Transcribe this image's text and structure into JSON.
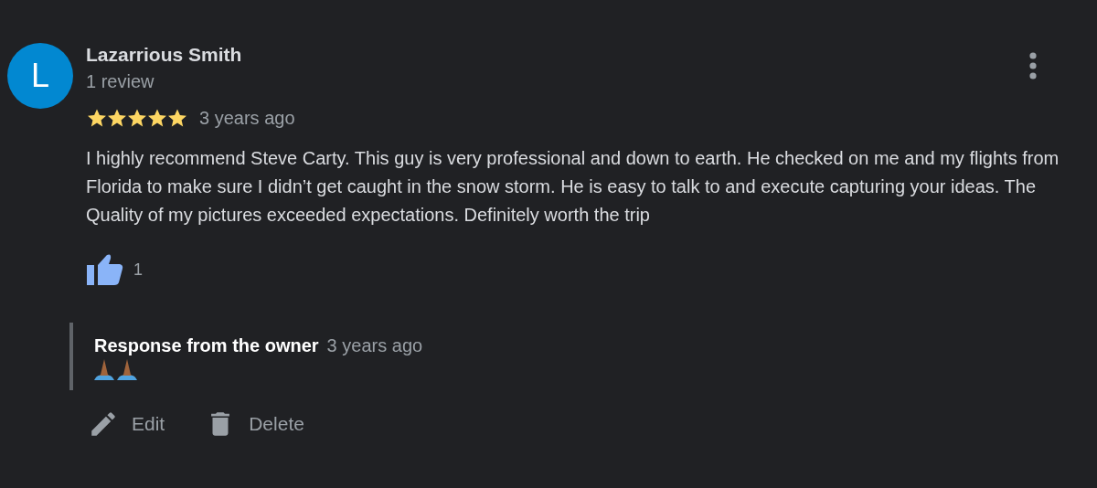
{
  "review": {
    "avatar_letter": "L",
    "author": "Lazarrious Smith",
    "author_meta": "1 review",
    "stars": 5,
    "time": "3 years ago",
    "text": "I highly recommend Steve Carty. This guy is very professional and down to earth. He checked on me and my flights from Florida to make sure I didn’t get caught in the snow storm. He is easy to talk to and execute capturing your ideas. The Quality of my pictures exceeded expectations. Definitely worth the trip",
    "liked": true,
    "like_count": "1"
  },
  "owner_response": {
    "title": "Response from the owner",
    "time": "3 years ago"
  },
  "actions": [
    {
      "kind": "edit",
      "label": "Edit"
    },
    {
      "kind": "delete",
      "label": "Delete"
    }
  ]
}
